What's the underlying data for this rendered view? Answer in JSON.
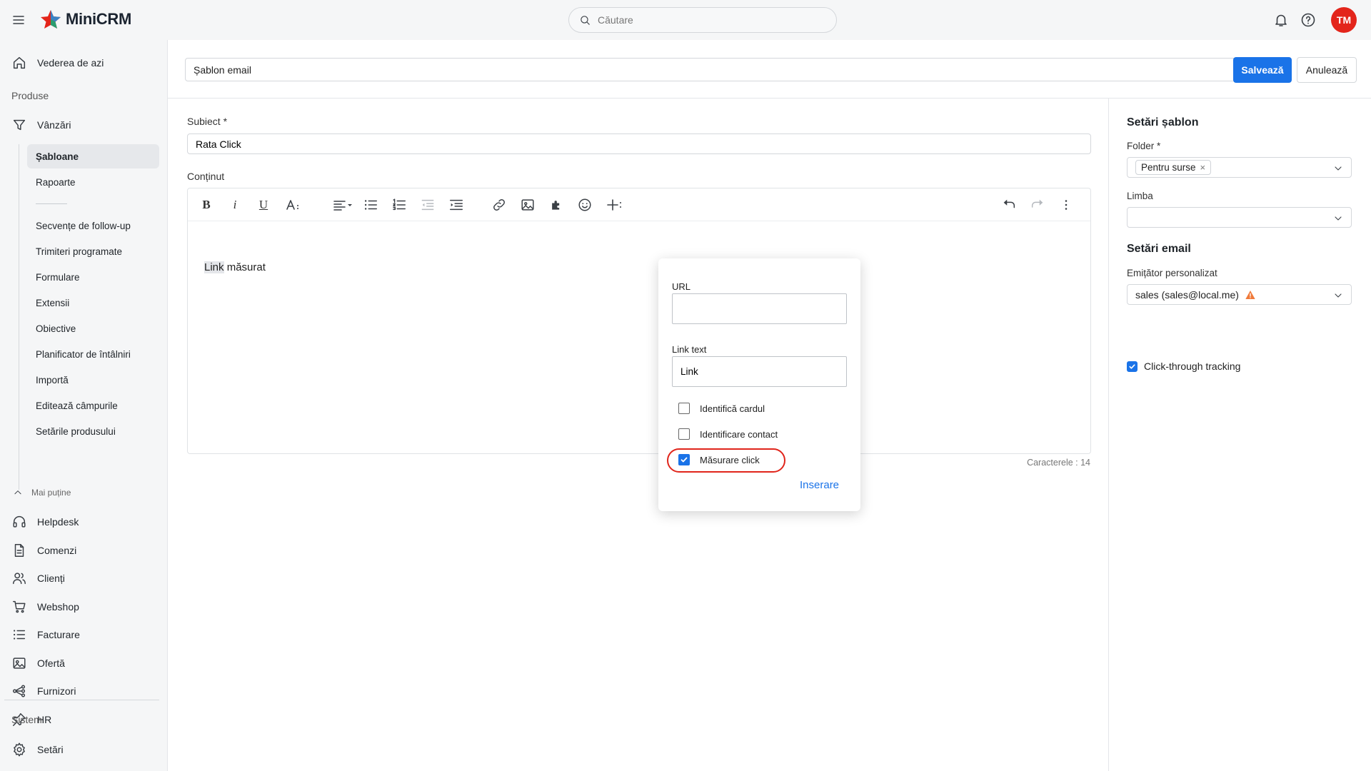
{
  "app": {
    "name": "MiniCRM"
  },
  "search": {
    "placeholder": "Căutare"
  },
  "user": {
    "initials": "TM",
    "avatar_color": "#e3251b"
  },
  "sidebar": {
    "today": "Vederea de azi",
    "section_products": "Produse",
    "sales": "Vânzări",
    "sub_items": [
      "Șabloane",
      "Rapoarte",
      "Secvențe de follow-up",
      "Trimiteri programate",
      "Formulare",
      "Extensii",
      "Obiective",
      "Planificator de întâlniri",
      "Importă",
      "Editează câmpurile",
      "Setările produsului"
    ],
    "less": "Mai puține",
    "modules": [
      "Helpdesk",
      "Comenzi",
      "Clienți",
      "Webshop",
      "Facturare",
      "Ofertă",
      "Furnizori",
      "HR"
    ],
    "section_system": "Sistem",
    "settings": "Setări"
  },
  "header": {
    "template_name": "Șablon email",
    "save_label": "Salvează",
    "cancel_label": "Anulează"
  },
  "form": {
    "subject_label": "Subiect *",
    "subject_value": "Rata Click",
    "content_label": "Conținut",
    "body_link": "Link",
    "body_rest": " măsurat",
    "char_counter": "Caracterele : 14"
  },
  "link_popover": {
    "url_label": "URL",
    "url_value": "",
    "link_text_label": "Link text",
    "link_text_value": "Link",
    "options": [
      {
        "label": "Identifică cardul",
        "checked": false
      },
      {
        "label": "Identificare contact",
        "checked": false
      },
      {
        "label": "Măsurare click",
        "checked": true
      }
    ],
    "insert_label": "Inserare"
  },
  "right_panel": {
    "template_settings": "Setări șablon",
    "folder_label": "Folder *",
    "folder_chip": "Pentru surse",
    "language_label": "Limba",
    "language_value": "",
    "email_settings": "Setări email",
    "sender_label": "Emițător personalizat",
    "sender_value": "sales (sales@local.me)",
    "tracking_label": "Click-through tracking",
    "tracking_checked": true
  },
  "colors": {
    "accent": "#1a73e8",
    "highlight_ring": "#e0251b",
    "warning": "#f07a3a"
  }
}
